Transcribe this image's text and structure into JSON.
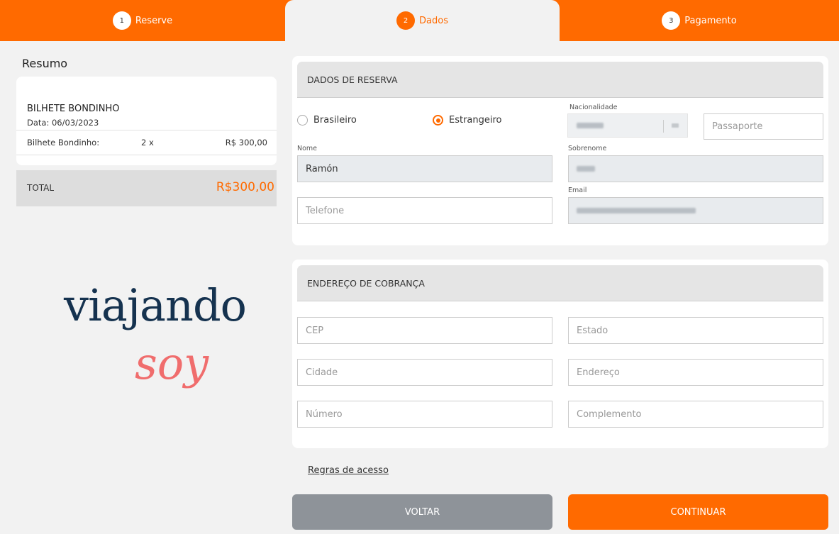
{
  "steps": [
    {
      "num": "1",
      "label": "Reserve"
    },
    {
      "num": "2",
      "label": "Dados"
    },
    {
      "num": "3",
      "label": "Pagamento"
    }
  ],
  "summary": {
    "title": "Resumo",
    "item_name": "BILHETE BONDINHO",
    "item_date": "Data: 06/03/2023",
    "line_label": "Bilhete Bondinho:",
    "line_qty": "2 x",
    "line_price": "R$ 300,00",
    "total_label": "TOTAL",
    "total_value": "R$300,00"
  },
  "logo": {
    "line1": "viajando",
    "line2": "soy"
  },
  "booking": {
    "header": "DADOS DE RESERVA",
    "radio_brasileiro": "Brasileiro",
    "radio_estrangeiro": "Estrangeiro",
    "nationality_label": "Nacionalidade",
    "passport_placeholder": "Passaporte",
    "nome_label": "Nome",
    "nome_value": "Ramón",
    "sobrenome_label": "Sobrenome",
    "telefone_placeholder": "Telefone",
    "email_label": "Email"
  },
  "billing": {
    "header": "ENDEREÇO DE COBRANÇA",
    "cep": "CEP",
    "estado": "Estado",
    "cidade": "Cidade",
    "endereco": "Endereço",
    "numero": "Número",
    "complemento": "Complemento"
  },
  "links": {
    "rules": "Regras de acesso"
  },
  "buttons": {
    "back": "VOLTAR",
    "next": "CONTINUAR"
  },
  "colors": {
    "accent": "#ff6a00",
    "back_button": "#8e9399",
    "logo_navy": "#15324f",
    "logo_coral": "#f06d6d"
  }
}
